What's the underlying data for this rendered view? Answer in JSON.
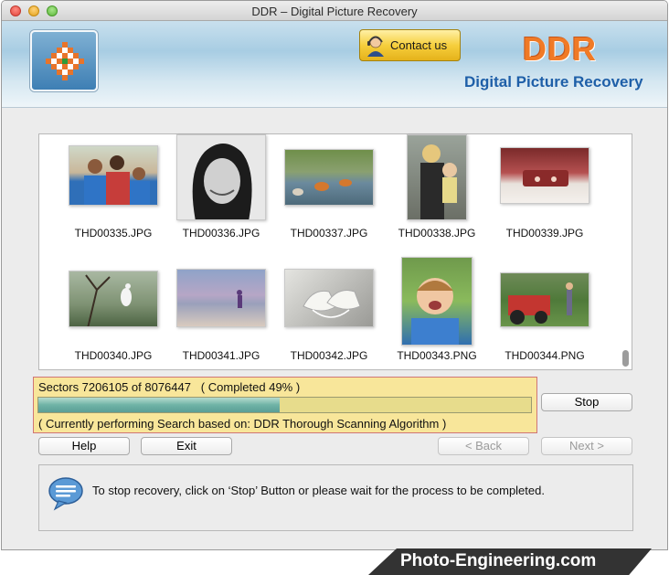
{
  "window": {
    "title": "DDR – Digital Picture Recovery"
  },
  "header": {
    "contact_label": "Contact us",
    "brand_name": "DDR",
    "brand_subtitle": "Digital Picture Recovery"
  },
  "gallery": {
    "items": [
      {
        "label": "THD00335.JPG"
      },
      {
        "label": "THD00336.JPG"
      },
      {
        "label": "THD00337.JPG"
      },
      {
        "label": "THD00338.JPG"
      },
      {
        "label": "THD00339.JPG"
      },
      {
        "label": "THD00340.JPG"
      },
      {
        "label": "THD00341.JPG"
      },
      {
        "label": "THD00342.JPG"
      },
      {
        "label": "THD00343.PNG"
      },
      {
        "label": "THD00344.PNG"
      }
    ]
  },
  "progress": {
    "sectors_text": "Sectors 7206105 of 8076447   ( Completed 49% )",
    "fraction": 0.49,
    "status_text": "( Currently performing Search based on: DDR Thorough Scanning Algorithm )"
  },
  "buttons": {
    "stop": "Stop",
    "help": "Help",
    "exit": "Exit",
    "back": "< Back",
    "next": "Next >"
  },
  "message": {
    "text": "To stop recovery, click on ‘Stop’ Button or please wait for the process to be completed."
  },
  "footer": {
    "text": "Photo-Engineering.com"
  },
  "colors": {
    "progress_panel": "#f8e69a",
    "progress_fill": "#6fb3a6",
    "brand_orange": "#f07a26",
    "brand_blue": "#1e5fa8"
  }
}
